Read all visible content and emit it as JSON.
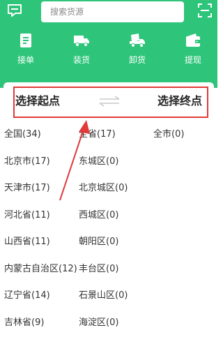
{
  "header": {
    "search_placeholder": "搜索货源",
    "nav": [
      {
        "label": "接单",
        "icon": "clipboard-icon"
      },
      {
        "label": "装货",
        "icon": "truck-icon"
      },
      {
        "label": "卸货",
        "icon": "unload-truck-icon"
      },
      {
        "label": "提现",
        "icon": "wallet-icon"
      }
    ]
  },
  "route": {
    "origin_label": "选择起点",
    "dest_label": "选择终点"
  },
  "lists": {
    "col1": [
      "全国(34)",
      "北京市(17)",
      "天津市(17)",
      "河北省(11)",
      "山西省(11)",
      "内蒙古自治区(12)",
      "辽宁省(14)",
      "吉林省(9)"
    ],
    "col2": [
      "全省(17)",
      "东城区(0)",
      "北京城区(0)",
      "西城区(0)",
      "朝阳区(0)",
      "丰台区(0)",
      "石景山区(0)",
      "海淀区(0)"
    ],
    "col3": [
      "全市(0)"
    ]
  },
  "colors": {
    "brand_green": "#2ec57a",
    "annotation_red": "#e03a3a"
  }
}
